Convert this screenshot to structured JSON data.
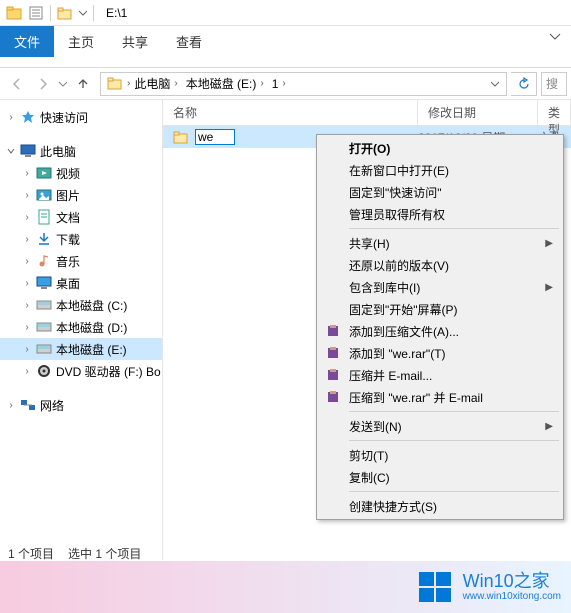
{
  "titlebar": {
    "path": "E:\\1"
  },
  "ribbon": {
    "tabs": {
      "file": "文件",
      "home": "主页",
      "share": "共享",
      "view": "查看"
    }
  },
  "breadcrumb": {
    "segs": [
      "此电脑",
      "本地磁盘 (E:)",
      "1"
    ]
  },
  "search": {
    "placeholder": "搜"
  },
  "sidebar": {
    "quick_access": "快速访问",
    "this_pc": "此电脑",
    "children": [
      {
        "label": "视频",
        "icon": "video"
      },
      {
        "label": "图片",
        "icon": "pictures"
      },
      {
        "label": "文档",
        "icon": "docs"
      },
      {
        "label": "下载",
        "icon": "downloads"
      },
      {
        "label": "音乐",
        "icon": "music"
      },
      {
        "label": "桌面",
        "icon": "desktop"
      },
      {
        "label": "本地磁盘 (C:)",
        "icon": "disk"
      },
      {
        "label": "本地磁盘 (D:)",
        "icon": "disk"
      },
      {
        "label": "本地磁盘 (E:)",
        "icon": "disk",
        "selected": true
      },
      {
        "label": "DVD 驱动器 (F:) Bo",
        "icon": "dvd"
      }
    ],
    "network": "网络"
  },
  "columns": {
    "name": "名称",
    "date": "修改日期",
    "type": "类型"
  },
  "rows": [
    {
      "name": "we",
      "renaming": true,
      "date": "2017/10/20 星期…",
      "type": "文件"
    }
  ],
  "context_menu": {
    "open": "打开(O)",
    "open_new_window": "在新窗口中打开(E)",
    "pin_quick_access": "固定到\"快速访问\"",
    "admin_take_ownership": "管理员取得所有权",
    "share": "共享(H)",
    "restore_previous": "还原以前的版本(V)",
    "include_in_library": "包含到库中(I)",
    "pin_to_start": "固定到\"开始\"屏幕(P)",
    "add_to_archive": "添加到压缩文件(A)...",
    "add_to_we_rar": "添加到 \"we.rar\"(T)",
    "compress_email": "压缩并 E-mail...",
    "compress_we_rar_email": "压缩到 \"we.rar\" 并 E-mail",
    "send_to": "发送到(N)",
    "cut": "剪切(T)",
    "copy": "复制(C)",
    "create_shortcut": "创建快捷方式(S)"
  },
  "statusbar": {
    "item_count": "1 个项目",
    "selected": "选中 1 个项目"
  },
  "watermark": {
    "big": "Win10之家",
    "small": "www.win10xitong.com"
  }
}
